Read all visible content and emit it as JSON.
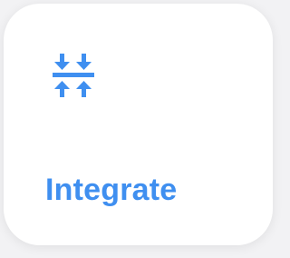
{
  "card": {
    "label": "Integrate",
    "icon": "merge-vertical-icon",
    "accent_color": "#3f8ff0",
    "background": "#ffffff"
  }
}
